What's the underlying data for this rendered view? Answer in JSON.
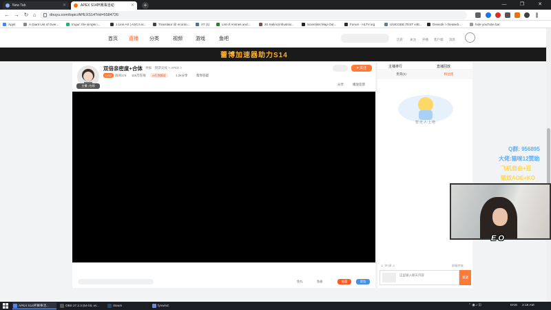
{
  "browser": {
    "tabs": [
      {
        "label": "New Tab",
        "active": false
      },
      {
        "label": "APEX S14杯赛事活动",
        "active": true
      }
    ],
    "url": "douyu.com/topic/APEXS14?rid=5584726",
    "window_controls": [
      "—",
      "❐",
      "✕"
    ]
  },
  "bookmarks": [
    "Apps",
    "A Giant List of Over...",
    "Imgur: the simple i...",
    "1 Line Art | ASCII ar...",
    "Translator @ econto...",
    "AT (1)",
    "List of Animes and...",
    "20 Satirical Illustrat...",
    "Scientists Map Out...",
    "Forum - HLTV.org",
    "UNICODE TEST v4E...",
    "Devie2k / cheaterb...",
    "hide youTube bar"
  ],
  "site_nav": {
    "links": [
      "首页",
      "直播",
      "分类",
      "视频",
      "游戏",
      "鱼吧"
    ],
    "active_index": 1,
    "right_items": [
      "历史",
      "关注",
      "开播",
      "客户端",
      "消息"
    ],
    "banner_text": "蕾博加速器助力S14"
  },
  "room": {
    "title": "双倍亲密度+合体",
    "title_suffix": "举报",
    "category": "网游竞技 > APEX >",
    "follow_label": "关注",
    "meta": [
      "LV12",
      "房间174",
      "115万在线",
      "AI打赏解说",
      "1.2k分享",
      "帮你答疑"
    ],
    "share_label": "分享",
    "report_label": "播放反馈",
    "avatar_tag": "主播 | 在线"
  },
  "video_bar": {
    "items": [
      "鱼丸",
      "鱼翅",
      "充值",
      "背包"
    ]
  },
  "side_panel": {
    "header_left": "主播排行",
    "header_right": "直播回放",
    "tabs": [
      "贵宾(0)",
      "粉丝团"
    ],
    "active_tab": 1,
    "mascot_text": "暂无人上榜",
    "chat_placeholder": "这里输入聊天内容",
    "send_label": "发送",
    "checkbox_label": "屏蔽特效"
  },
  "overlay": {
    "lines": [
      {
        "text": "Q群: 956895",
        "color": "#5ab0ff"
      },
      {
        "text": "大佬:猫咪12赞助",
        "color": "#5ab0ff"
      },
      {
        "text": "飞机自由+豆",
        "color": "#ffd54a"
      },
      {
        "text": "猫奴AOE+KO",
        "color": "#ffd54a"
      }
    ],
    "webcam_tag": "E O"
  },
  "taskbar": {
    "items": [
      {
        "label": "APEX S14杯赛事活...",
        "active": true,
        "color": "#4c8bf5"
      },
      {
        "label": "OBS 27.2.3 (64-bit, wi...",
        "active": false,
        "color": "#555"
      },
      {
        "label": "Steam",
        "active": false,
        "color": "#2a475e"
      },
      {
        "label": "fynwind.",
        "active": false,
        "color": "#7289da"
      }
    ],
    "lang": "ENG",
    "time": "2:18 AM"
  }
}
